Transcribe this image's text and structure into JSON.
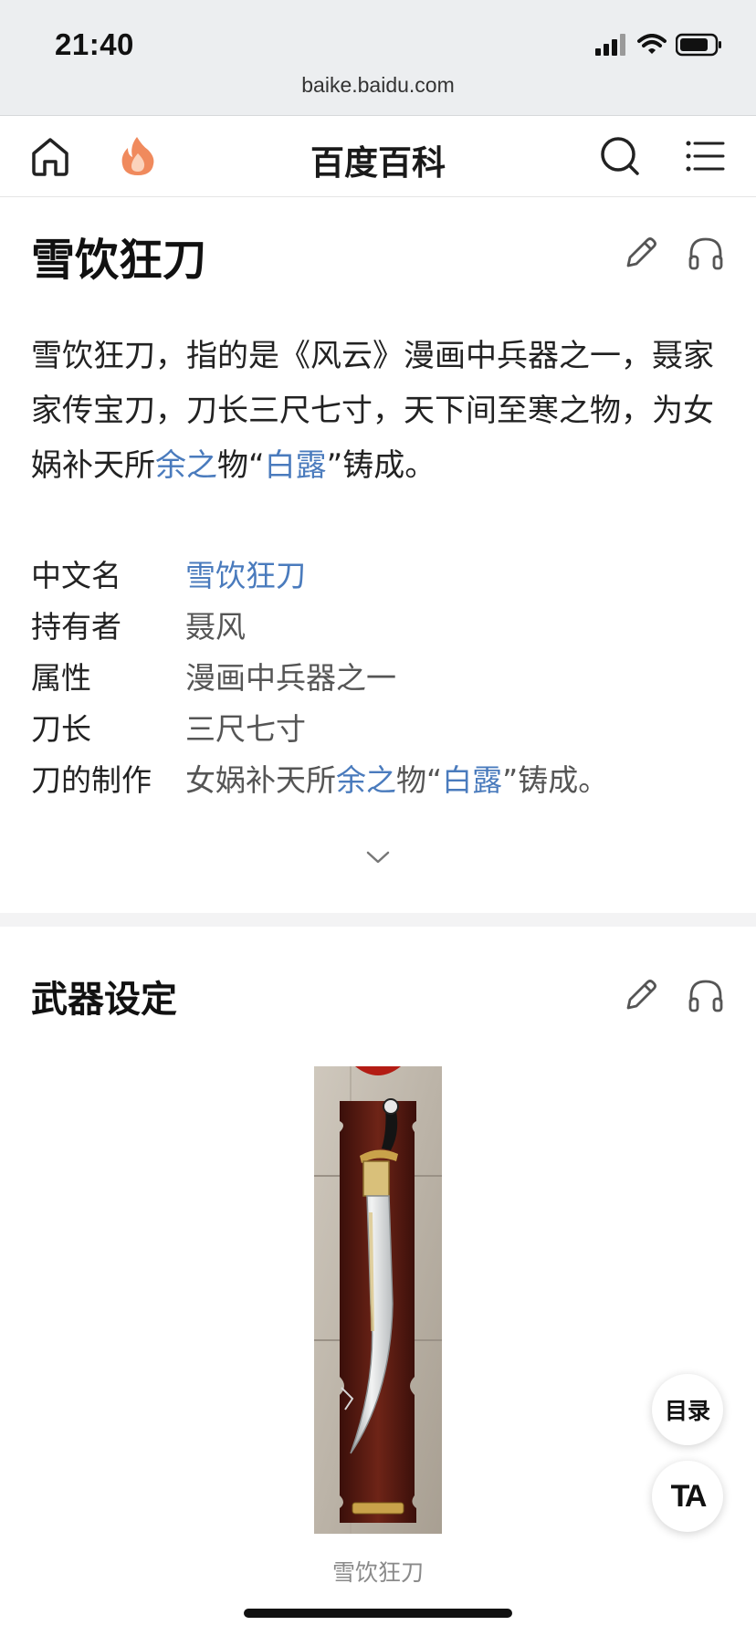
{
  "status_bar": {
    "time": "21:40",
    "url": "baike.baidu.com"
  },
  "navbar": {
    "title": "百度百科",
    "icons": [
      "home-icon",
      "fire-icon",
      "search-icon",
      "menu-icon"
    ]
  },
  "article": {
    "title": "雪饮狂刀",
    "summary": {
      "part1": "雪饮狂刀，指的是《风云》漫画中兵器之一，聂家家传宝刀，刀长三尺七寸，天下间至寒之物，为女娲补天所",
      "link1": "余之",
      "part2": "物“",
      "link2": "白露",
      "part3": "”铸成。"
    },
    "infobox": {
      "row1": {
        "key": "中文名",
        "value": "雪饮狂刀"
      },
      "row2": {
        "key": "持有者",
        "value": "聂风"
      },
      "row3": {
        "key": "属性",
        "value": "漫画中兵器之一"
      },
      "row4": {
        "key": "刀长",
        "value": "三尺七寸"
      },
      "row5": {
        "key": "刀的制作",
        "value_part1": "女娲补天所",
        "value_link1": "余之",
        "value_part2": "物“",
        "value_link2": "白露",
        "value_part3": "”铸成。"
      }
    },
    "section": {
      "title": "武器设定",
      "image_caption": "雪饮狂刀"
    }
  },
  "floating": {
    "toc_label": "目录",
    "font_label": "TA"
  },
  "colors": {
    "link": "#4a7bbd",
    "fire": "#f08a5d",
    "divider": "#f3f3f4"
  }
}
